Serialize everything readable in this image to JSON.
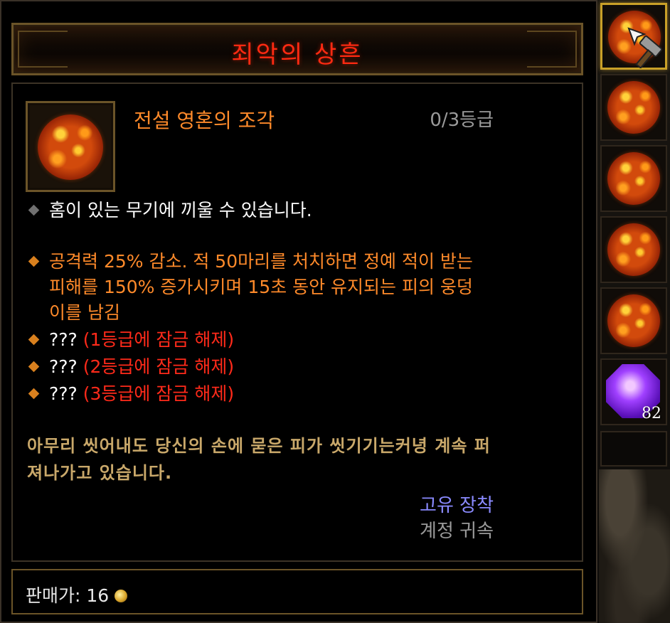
{
  "tooltip": {
    "title": "죄악의 상흔",
    "item_name": "전설 영혼의 조각",
    "rank": "0/3등급",
    "socket_text": "홈이 있는 무기에 끼울 수 있습니다.",
    "effect_line1": "공격력 25% 감소. 적 50마리를 처치하면 정예 적이 받는",
    "effect_line2": "피해를 150% 증가시키며 15초 동안 유지되는 피의 웅덩",
    "effect_line3": "이를 남김",
    "locked": [
      {
        "text": "???",
        "unlock": "(1등급에 잠금 해제)"
      },
      {
        "text": "???",
        "unlock": "(2등급에 잠금 해제)"
      },
      {
        "text": "???",
        "unlock": "(3등급에 잠금 해제)"
      }
    ],
    "flavor_line1": "아무리 씻어내도 당신의 손에 묻은 피가 씻기기는커녕 계속 퍼",
    "flavor_line2": "져나가고 있습니다.",
    "unique_equipped": "고유 장착",
    "account_bound": "계정 귀속",
    "sell_label": "판매가: 16"
  },
  "sidebar": {
    "gem_count": "82"
  },
  "colors": {
    "title": "#ff2a12",
    "item_name": "#ff8a2a",
    "locked": "#ff2a1a",
    "flavor": "#c9a86a",
    "unique": "#8a8aff",
    "frame_gold": "#6b5428"
  },
  "icons": [
    "blood-shard-orb-icon",
    "hammer-cursor-icon",
    "amethyst-gem-icon",
    "gold-coin-icon"
  ]
}
